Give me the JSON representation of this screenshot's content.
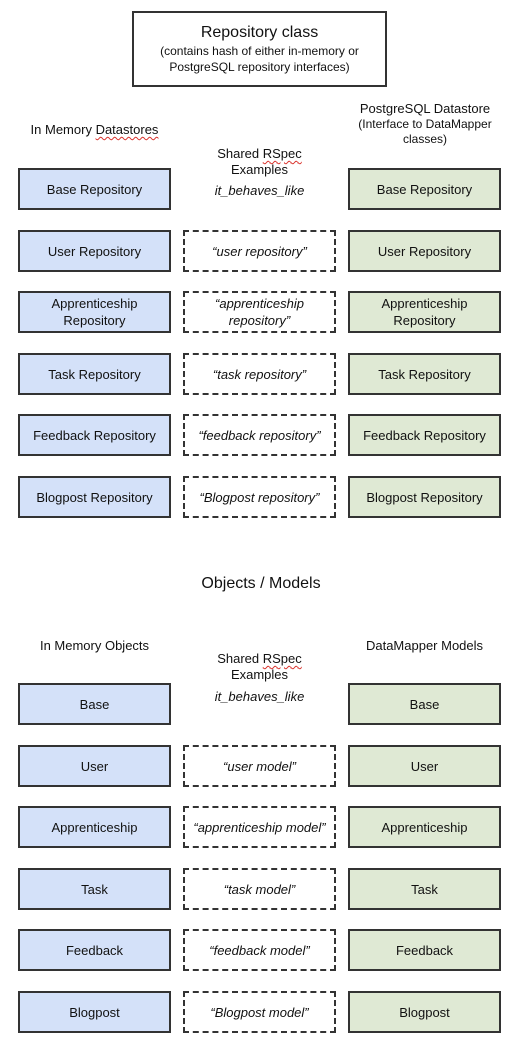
{
  "header": {
    "title": "Repository class",
    "subtitle_line1": "(contains hash of either in-memory or",
    "subtitle_line2": "PostgreSQL repository interfaces)"
  },
  "repositories": {
    "left_heading_prefix": "In Memory ",
    "left_heading_squiggle": "Datastores",
    "right_heading_line1": "PostgreSQL Datastore",
    "right_heading_line2": "(Interface to DataMapper",
    "right_heading_line3": "classes)",
    "shared_heading_prefix": "Shared ",
    "shared_heading_squiggle": "RSpec",
    "shared_heading_line2": "Examples",
    "shared_method": "it_behaves_like",
    "rows": [
      {
        "left": "Base Repository",
        "shared": "",
        "right": "Base Repository"
      },
      {
        "left": "User Repository",
        "shared": "“user repository”",
        "right": "User Repository"
      },
      {
        "left": "Apprenticeship Repository",
        "shared": "“apprenticeship repository”",
        "right": "Apprenticeship Repository"
      },
      {
        "left": "Task Repository",
        "shared": "“task repository”",
        "right": "Task Repository"
      },
      {
        "left": "Feedback Repository",
        "shared": "“feedback repository”",
        "right": "Feedback Repository"
      },
      {
        "left": "Blogpost Repository",
        "shared": "“Blogpost repository”",
        "right": "Blogpost Repository"
      }
    ]
  },
  "models": {
    "section_title": "Objects / Models",
    "left_heading": "In Memory Objects",
    "right_heading": "DataMapper Models",
    "shared_heading_prefix": "Shared ",
    "shared_heading_squiggle": "RSpec",
    "shared_heading_line2": "Examples",
    "shared_method": "it_behaves_like",
    "rows": [
      {
        "left": "Base",
        "shared": "",
        "right": "Base"
      },
      {
        "left": "User",
        "shared": "“user model”",
        "right": "User"
      },
      {
        "left": "Apprenticeship",
        "shared": "“apprenticeship model”",
        "right": "Apprenticeship"
      },
      {
        "left": "Task",
        "shared": "“task model”",
        "right": "Task"
      },
      {
        "left": "Feedback",
        "shared": "“feedback model”",
        "right": "Feedback"
      },
      {
        "left": "Blogpost",
        "shared": "“Blogpost model”",
        "right": "Blogpost"
      }
    ]
  },
  "colors": {
    "in_memory_fill": "#d4e1f9",
    "postgres_fill": "#dfe9d4",
    "border": "#333333"
  }
}
